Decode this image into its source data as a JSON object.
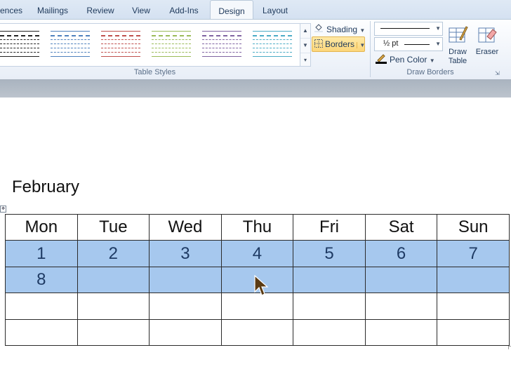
{
  "ribbon": {
    "tabs": [
      {
        "id": "references",
        "label": "ences"
      },
      {
        "id": "mailings",
        "label": "Mailings"
      },
      {
        "id": "review",
        "label": "Review"
      },
      {
        "id": "view",
        "label": "View"
      },
      {
        "id": "addins",
        "label": "Add-Ins"
      },
      {
        "id": "design",
        "label": "Design",
        "active": true
      },
      {
        "id": "layout",
        "label": "Layout"
      }
    ],
    "table_styles": {
      "group_label": "Table Styles",
      "shading_label": "Shading",
      "borders_label": "Borders",
      "thumb_colors": [
        "#222222",
        "#4f81bd",
        "#c0504d",
        "#9bbb59",
        "#8064a2",
        "#4bacc6"
      ]
    },
    "draw_borders": {
      "group_label": "Draw Borders",
      "line_weight": "½ pt",
      "pen_color_label": "Pen Color",
      "draw_table_label": "Draw Table",
      "eraser_label": "Eraser"
    }
  },
  "document": {
    "title": "February",
    "calendar": {
      "headers": [
        "Mon",
        "Tue",
        "Wed",
        "Thu",
        "Fri",
        "Sat",
        "Sun"
      ],
      "rows": [
        [
          "1",
          "2",
          "3",
          "4",
          "5",
          "6",
          "7"
        ],
        [
          "8",
          "",
          "",
          "",
          "",
          "",
          ""
        ],
        [
          "",
          "",
          "",
          "",
          "",
          "",
          ""
        ],
        [
          "",
          "",
          "",
          "",
          "",
          "",
          ""
        ]
      ],
      "selected_rows": [
        0,
        1
      ],
      "highlight_color": "#a6c8ee"
    }
  }
}
